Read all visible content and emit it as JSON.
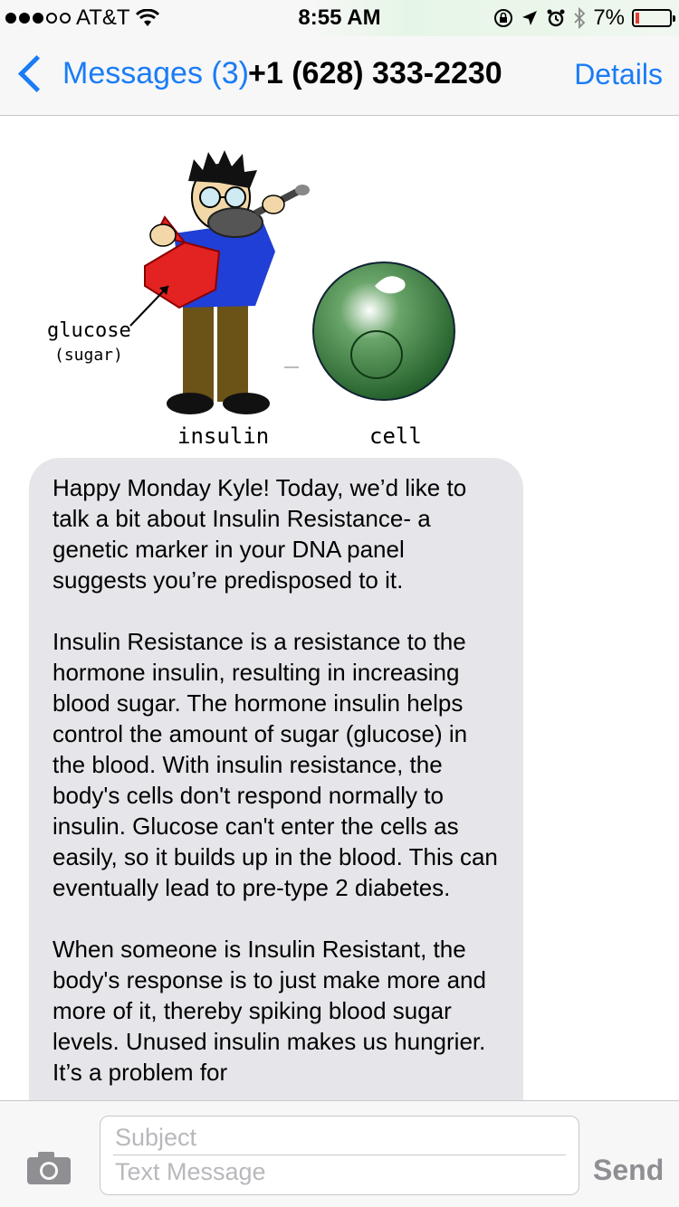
{
  "status_bar": {
    "carrier": "AT&T",
    "time": "8:55 AM",
    "battery": "7%",
    "battery_level": 0.07
  },
  "nav": {
    "back_label": "Messages (3)",
    "title": "+1 (628) 333-2230",
    "details_label": "Details"
  },
  "image_message": {
    "label_glucose": "glucose",
    "label_sugar": "(sugar)",
    "label_insulin": "insulin",
    "label_cell": "cell"
  },
  "message": {
    "paragraphs": [
      "Happy Monday Kyle! Today, we’d like to talk a bit about Insulin Resistance- a genetic marker in your DNA panel suggests you’re predisposed to it.",
      "Insulin Resistance is a resistance to the hormone insulin, resulting in increasing blood sugar. The hormone insulin helps control the amount of sugar (glucose) in the blood. With insulin resistance, the body's cells don't respond normally to insulin. Glucose can't enter the cells as easily, so it builds up in the blood. This can eventually lead to pre-type 2 diabetes.",
      "When someone is Insulin Resistant, the body's response is to just make more and more of it, thereby spiking blood sugar levels. Unused insulin makes us hungrier. It’s a problem for"
    ]
  },
  "input_bar": {
    "subject_placeholder": "Subject",
    "text_placeholder": "Text Message",
    "send_label": "Send"
  },
  "colors": {
    "accent": "#1a7cf6",
    "bubble": "#e5e5ea",
    "placeholder": "#b8b8bd"
  }
}
